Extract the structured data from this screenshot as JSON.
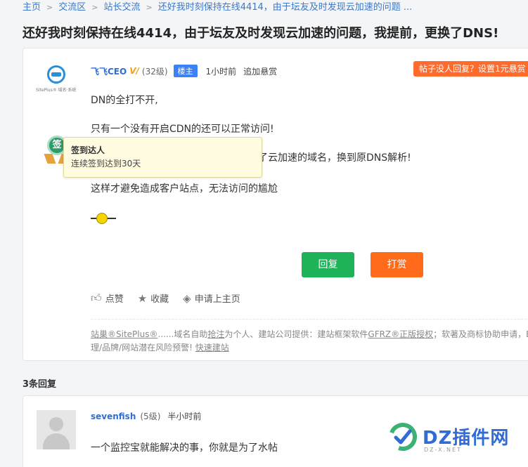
{
  "breadcrumb": {
    "items": [
      "主页",
      "交流区",
      "站长交流",
      "还好我时刻保持在线4414，由于坛友及时发现云加速的问题 ..."
    ]
  },
  "page_title": "还好我时刻保持在线4414，由于坛友及时发现云加速的问题，我提前，更换了DNS!",
  "post": {
    "logo_text": "SitePlus® 域名·系统",
    "author": "飞飞CEO",
    "verified_mark": "V/",
    "level": "(32级)",
    "owner_badge": "楼主",
    "time": "1小时前",
    "add_reward": "追加悬赏",
    "promo": "帖子没人回复？设置1元悬赏",
    "medal_char": "签",
    "tooltip": {
      "title": "签到达人",
      "desc": "连续签到达到30天"
    },
    "lines": [
      "DN的全打不开,",
      "只有一个没有开启CDN的还可以正常访问!",
      "由于发现的及时，果断的，把所有使用了云加速的域名，换到原DNS解析!",
      "这样才避免造成客户站点，无法访问的尴尬"
    ],
    "reply_button": "回复",
    "tip_button": "打赏",
    "actions": {
      "like": "点赞",
      "favorite": "收藏",
      "apply_home": "申请上主页"
    },
    "footer": {
      "link1": "站巢®SitePlus®",
      "text1": "......域名自助",
      "link2": "抢注",
      "text2": "为个人、建站公司提供：建站框架软件",
      "link3": "GFRZ®正版授权",
      "text3": "；软著及商标协助申请，ED",
      "text4": "理/品牌/网站潜在风险预警!",
      "link4": "快速建站"
    }
  },
  "replies": {
    "count_label": "3条回复",
    "items": [
      {
        "author": "sevenfish",
        "level": "(5级)",
        "time": "半小时前",
        "text": "一个监控宝就能解决的事，你就是为了水帖"
      }
    ]
  },
  "watermark": {
    "text": "DZ插件网",
    "sub": "DZ-X.NET"
  },
  "colors": {
    "reply": "#1eb358",
    "tip": "#ff6b1a",
    "link": "#2f6cd4",
    "promo": "#ff6b2c"
  }
}
